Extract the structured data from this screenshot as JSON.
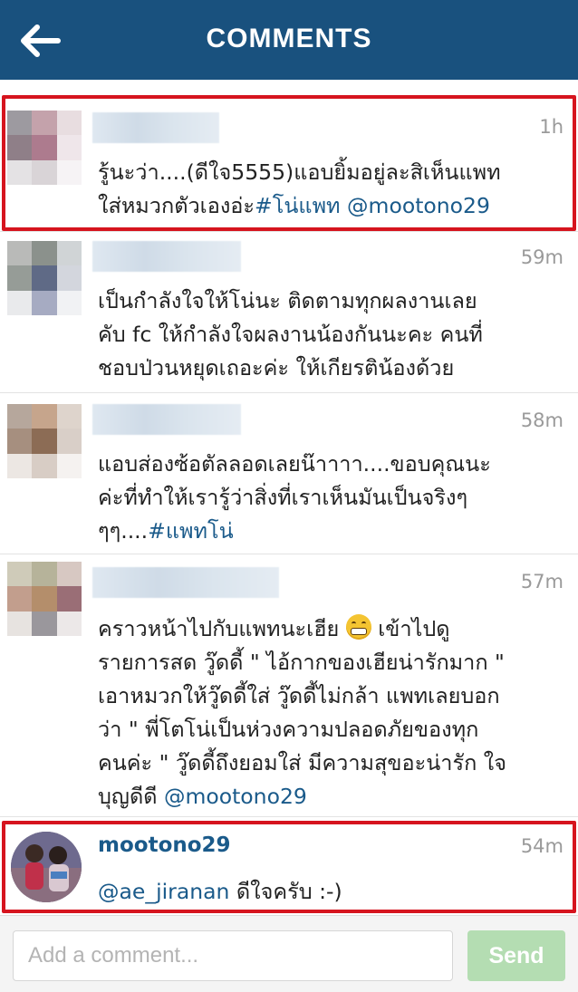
{
  "header": {
    "title": "COMMENTS",
    "back_icon": "arrow-left-icon",
    "bg": "#19517e"
  },
  "comments": [
    {
      "time": "1h",
      "text": "รู้นะว่า....(ดีใจ5555)แอบยิ้มอยู่ละสิเห็นแพท\nใส่หมวกตัวเองอ่ะ",
      "hashtag": "#โน่แพท",
      "mention": "@mootono29",
      "highlighted": true
    },
    {
      "time": "59m",
      "text": "เป็นกำลังใจให้โน่นะ ติดตามทุกผลงานเลย\nคับ fc ให้กำลังใจผลงานน้องกันนะคะ  คนที่\nชอบป่วนหยุดเถอะค่ะ  ให้เกียรติน้องด้วย"
    },
    {
      "time": "58m",
      "text": "แอบส่องซ้อตัลลอดเลยน๊าาาา....ขอบคุณนะ\nค่ะที่ทำให้เรารู้ว่าสิ่งที่เราเห็นมันเป็นจริงๆ\nๆๆ....",
      "hashtag": "#แพทโน่"
    },
    {
      "time": "57m",
      "text_before_emoji": "คราวหน้าไปกับแพทนะเฮีย ",
      "emoji": "grimacing-face-emoji",
      "text_after_emoji": " เข้าไปดู",
      "text_rest": "รายการสด วู๊ดดี้ \" ไอ้กากของเฮียน่ารักมาก \"\nเอาหมวกให้วู๊ดดี้ใส่ วู๊ดดี้ไม่กล้า แพทเลยบอก\nว่า \" พี่โตโน่เป็นห่วงความปลอดภัยของทุก\nคนค่ะ \" วู๊ดดี้ถึงยอมใส่ มีความสุขอะน่ารัก  ใจ\nบุญดีดี ",
      "mention": "@mootono29"
    },
    {
      "username": "mootono29",
      "time": "54m",
      "mention": "@ae_jiranan",
      "text": " ดีใจครับ :-)",
      "highlighted": true
    }
  ],
  "composer": {
    "placeholder": "Add a comment...",
    "send_label": "Send",
    "send_color": "#b4ddb2"
  },
  "colors": {
    "highlight": "#d6141e",
    "link": "#1a5a8a"
  }
}
